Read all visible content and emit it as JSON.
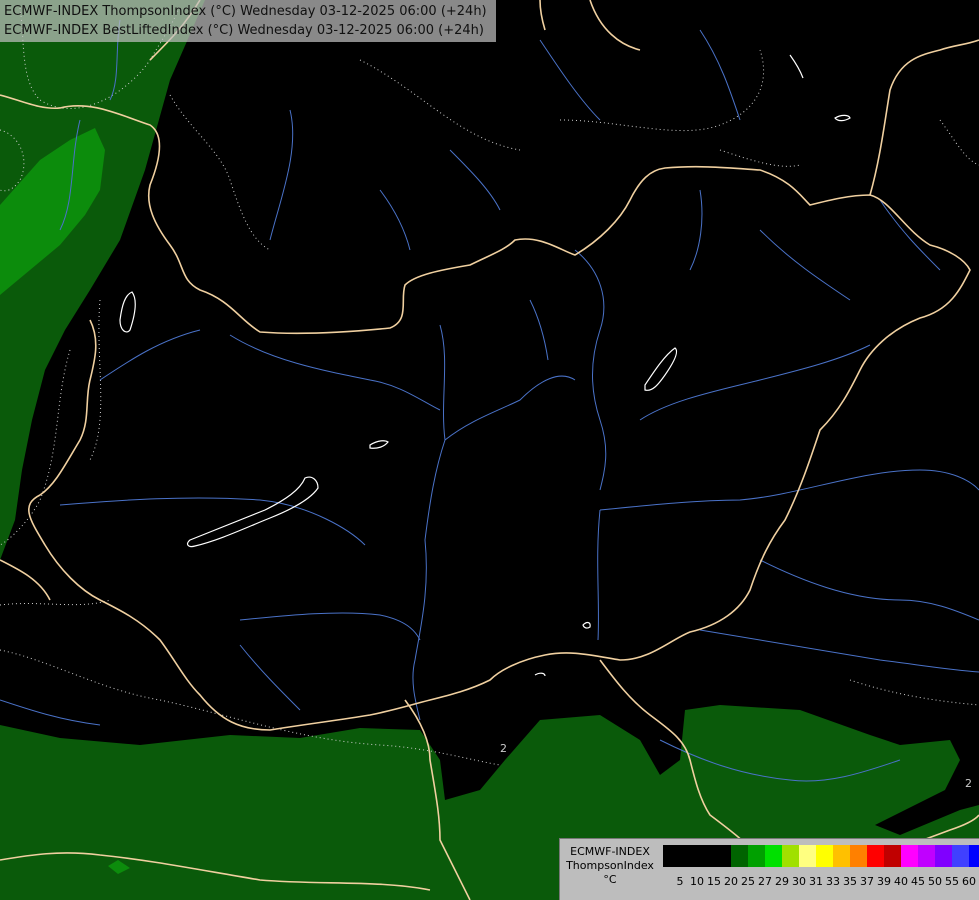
{
  "title_lines": [
    "ECMWF-INDEX ThompsonIndex (°C) Wednesday 03-12-2025 06:00 (+24h)",
    "ECMWF-INDEX BestLiftedIndex (°C) Wednesday 03-12-2025 06:00 (+24h)"
  ],
  "legend": {
    "lines": [
      "ECMWF-INDEX",
      "ThompsonIndex",
      "°C"
    ],
    "thresholds": [
      "5",
      "10",
      "15",
      "20",
      "25",
      "27",
      "29",
      "30",
      "31",
      "33",
      "35",
      "37",
      "39",
      "40",
      "45",
      "50",
      "55",
      "60"
    ],
    "colors": [
      "#000000",
      "#000000",
      "#000000",
      "#000000",
      "#006400",
      "#00a000",
      "#00e000",
      "#a0e000",
      "#ffff80",
      "#ffff00",
      "#ffc000",
      "#ff8000",
      "#ff0000",
      "#c00000",
      "#ff00ff",
      "#c000ff",
      "#8000ff",
      "#4040ff",
      "#0000ff"
    ]
  },
  "contour_labels": [
    "2",
    "2",
    "2"
  ],
  "colors": {
    "dark_green": "#0a5a0a",
    "mid_green": "#0c8c0c",
    "border": "#f0d0a0",
    "river": "#4a72c8",
    "lake": "#ffffff"
  }
}
